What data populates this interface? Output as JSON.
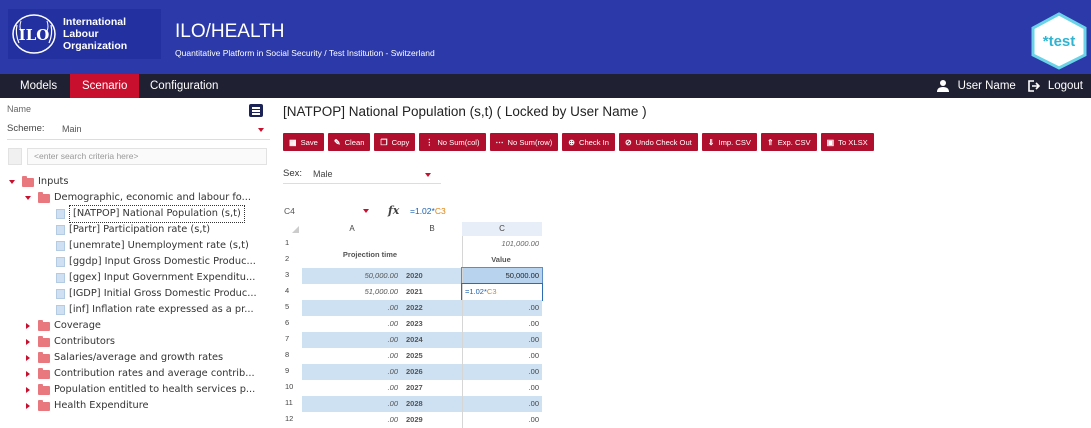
{
  "header": {
    "org_line1": "International",
    "org_line2": "Labour",
    "org_line3": "Organization",
    "logo_letters": "ILO",
    "title": "ILO/HEALTH",
    "subtitle": "Quantitative Platform in Social Security / Test Institution - Switzerland",
    "env_badge": "*test"
  },
  "menubar": {
    "items": [
      "Models",
      "Scenario",
      "Configuration"
    ],
    "active": "Scenario",
    "user_name": "User Name",
    "logout": "Logout"
  },
  "sidebar": {
    "name_label": "Name",
    "scheme_label": "Scheme:",
    "scheme_value": "Main",
    "search_placeholder": "<enter search criteria here>",
    "tree": [
      "Inputs",
      "Demographic, economic and labour fo...",
      "[NATPOP] National Population (s,t)",
      "[Partr] Participation rate (s,t)",
      "[unemrate] Unemployment rate (s,t)",
      "[ggdp] Input Gross Domestic Produc...",
      "[ggex] Input Government Expenditu...",
      "[IGDP] Initial Gross Domestic Produc...",
      "[inf] Inflation rate expressed as a pr...",
      "Coverage",
      "Contributors",
      "Salaries/average and growth rates",
      "Contribution rates and average contrib...",
      "Population entitled to health services p...",
      "Health Expenditure"
    ]
  },
  "main": {
    "title": "[NATPOP] National Population (s,t) ( Locked by User Name )",
    "toolbar": [
      "Save",
      "Clean",
      "Copy",
      "No Sum(col)",
      "No Sum(row)",
      "Check In",
      "Undo Check Out",
      "Imp. CSV",
      "Exp. CSV",
      "To XLSX"
    ],
    "sex_label": "Sex:",
    "sex_value": "Male",
    "cell_ref": "C4",
    "formula_prefix": "=1.02*",
    "formula_ref": "C3",
    "col_headers": [
      "A",
      "B",
      "C"
    ],
    "header_projection": "Projection time",
    "header_c1": "101,000.00",
    "header_value": "Value",
    "row_numbers": [
      "1",
      "2",
      "3",
      "4",
      "5",
      "6",
      "7",
      "8",
      "9",
      "10",
      "11",
      "12"
    ],
    "rows": [
      {
        "a": "50,000.00",
        "b": "2020",
        "c": "50,000.00"
      },
      {
        "a": "51,000.00",
        "b": "2021",
        "c": "=1.02*C3"
      },
      {
        "a": ".00",
        "b": "2022",
        "c": ".00"
      },
      {
        "a": ".00",
        "b": "2023",
        "c": ".00"
      },
      {
        "a": ".00",
        "b": "2024",
        "c": ".00"
      },
      {
        "a": ".00",
        "b": "2025",
        "c": ".00"
      },
      {
        "a": ".00",
        "b": "2026",
        "c": ".00"
      },
      {
        "a": ".00",
        "b": "2027",
        "c": ".00"
      },
      {
        "a": ".00",
        "b": "2028",
        "c": ".00"
      },
      {
        "a": ".00",
        "b": "2029",
        "c": ".00"
      }
    ]
  },
  "colors": {
    "header_bg": "#2b3aa8",
    "menubar_bg": "#1f2032",
    "accent_red": "#c8102e",
    "button_red": "#b10f2e",
    "cell_highlight": "#cde1f3"
  }
}
